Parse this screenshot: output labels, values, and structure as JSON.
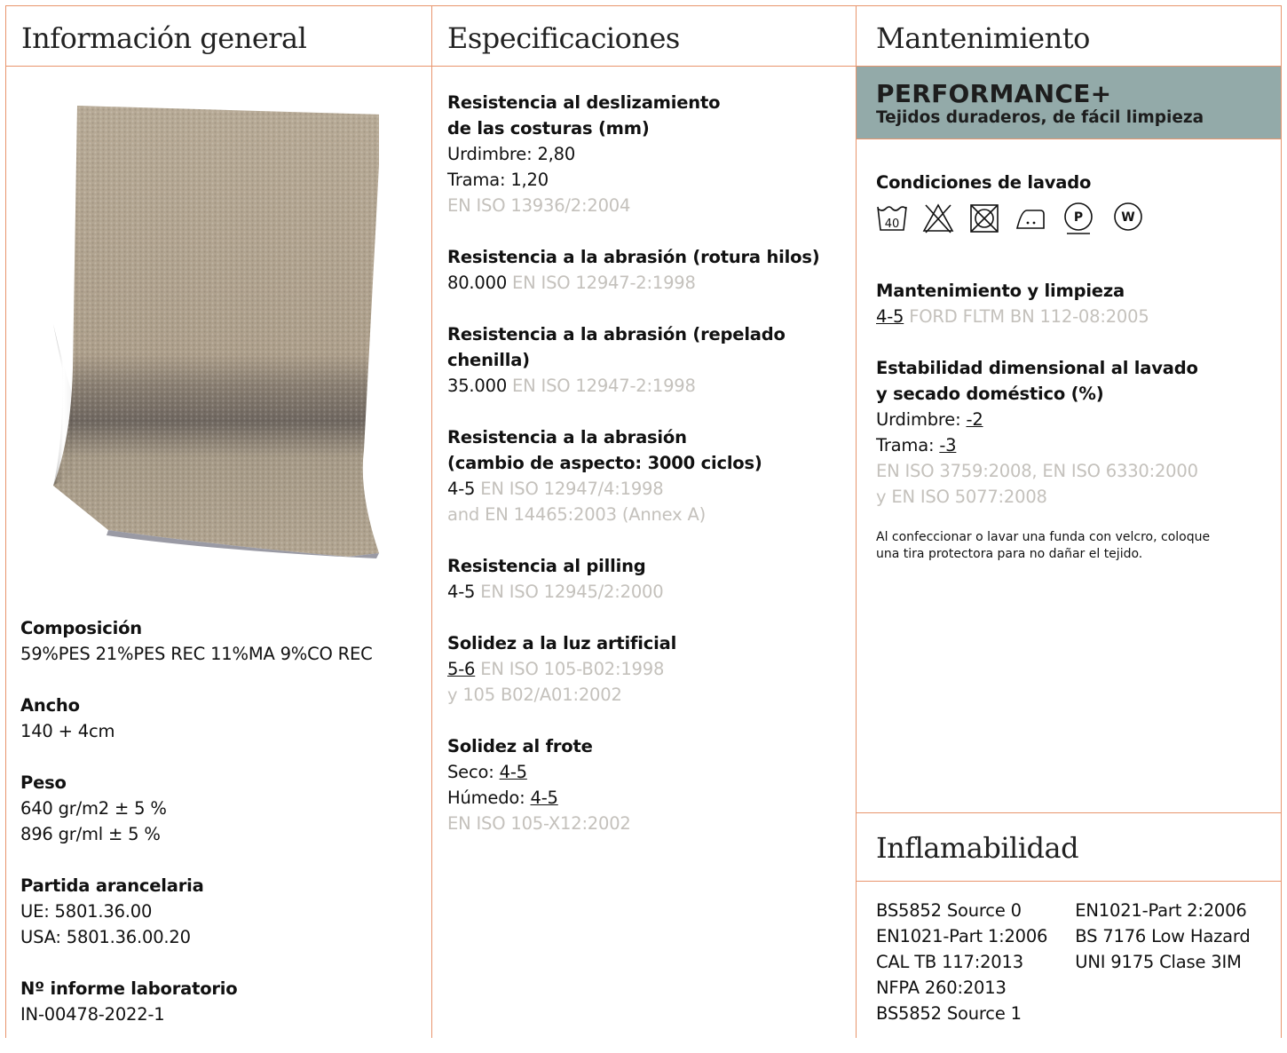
{
  "columns": {
    "general": "Información general",
    "specs": "Especificaciones",
    "maintenance": "Mantenimiento",
    "flammability": "Inflamabilidad"
  },
  "general": [
    {
      "label": "Composición",
      "lines": [
        "59%PES 21%PES REC 11%MA 9%CO REC"
      ]
    },
    {
      "label": "Ancho",
      "lines": [
        "140 + 4cm"
      ]
    },
    {
      "label": "Peso",
      "lines": [
        "640 gr/m2 ± 5 %",
        "896 gr/ml ± 5 %"
      ]
    },
    {
      "label": "Partida arancelaria",
      "lines": [
        "UE: 5801.36.00",
        "USA: 5801.36.00.20"
      ]
    },
    {
      "label": "Nº informe laboratorio",
      "lines": [
        "IN-00478-2022-1"
      ]
    }
  ],
  "specs": {
    "seam": {
      "label1": "Resistencia al deslizamiento",
      "label2": "de las costuras (mm)",
      "warp": "Urdimbre: 2,80",
      "weft": "Trama: 1,20",
      "std": "EN ISO 13936/2:2004"
    },
    "abrasion_break": {
      "label": "Resistencia a la abrasión (rotura hilos)",
      "value": "80.000",
      "std": "EN ISO 12947-2:1998"
    },
    "abrasion_pill": {
      "label1": "Resistencia a la abrasión (repelado",
      "label2": "chenilla)",
      "value": "35.000",
      "std": "EN ISO 12947-2:1998"
    },
    "abrasion_look": {
      "label1": "Resistencia a la abrasión",
      "label2": "(cambio de aspecto: 3000 ciclos)",
      "value": "4-5",
      "std1": "EN ISO 12947/4:1998",
      "std2": "and EN 14465:2003 (Annex A)"
    },
    "pilling": {
      "label": "Resistencia al pilling",
      "value": "4-5",
      "std": "EN ISO 12945/2:2000"
    },
    "light": {
      "label": "Solidez a la luz artificial",
      "value": "5-6",
      "std1": "EN ISO 105-B02:1998",
      "std2": "y 105 B02/A01:2002"
    },
    "rubbing": {
      "label": "Solidez al frote",
      "dry_label": "Seco:",
      "dry": "4-5",
      "wet_label": "Húmedo:",
      "wet": "4-5",
      "std": "EN ISO 105-X12:2002"
    }
  },
  "maintenance": {
    "perf_title": "PERFORMANCE+",
    "perf_sub": "Tejidos duraderos, de fácil limpieza",
    "wash_label": "Condiciones de lavado",
    "wash_temp": "40",
    "dry_clean_p": "P",
    "wet_clean_w": "W",
    "clean_label": "Mantenimiento y limpieza",
    "clean_value": "4-5",
    "clean_std": "FORD FLTM BN 112-08:2005",
    "stab_label1": "Estabilidad dimensional al lavado",
    "stab_label2": "y secado doméstico (%)",
    "stab_warp_label": "Urdimbre:",
    "stab_warp": "-2",
    "stab_weft_label": "Trama:",
    "stab_weft": "-3",
    "stab_std1": "EN ISO 3759:2008, EN ISO 6330:2000",
    "stab_std2": "y EN ISO 5077:2008",
    "note1": "Al confeccionar o lavar una funda con velcro, coloque",
    "note2": "una tira protectora para no dañar el tejido."
  },
  "flammability": {
    "left": [
      "BS5852 Source 0",
      "EN1021-Part 1:2006",
      "CAL TB 117:2013",
      "NFPA 260:2013",
      "BS5852 Source 1"
    ],
    "right": [
      "EN1021-Part 2:2006",
      "BS 7176 Low Hazard",
      "UNI 9175 Clase 3IM"
    ]
  }
}
